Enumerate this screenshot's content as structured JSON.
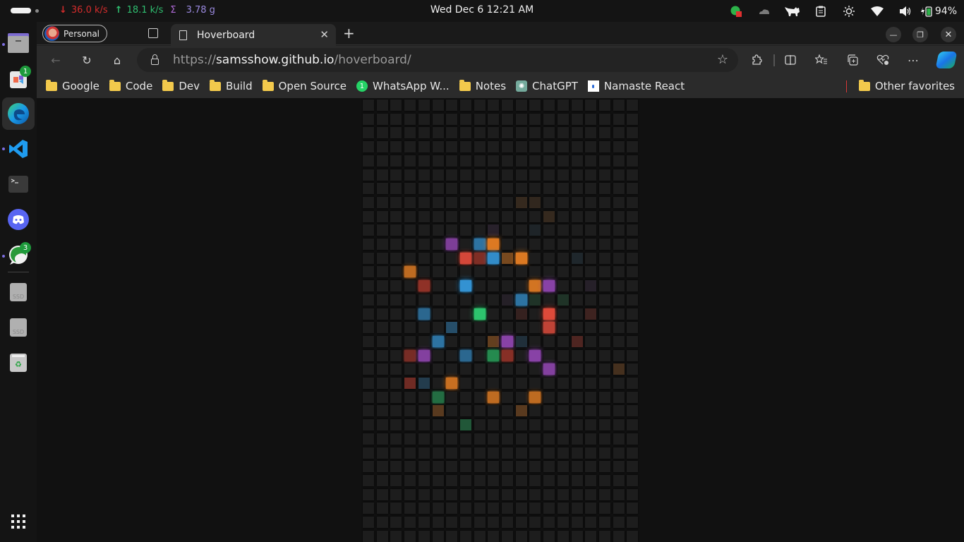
{
  "system_bar": {
    "net_down_icon": "arrow-down-icon",
    "net_down": "36.0 k/s",
    "net_up_icon": "arrow-up-icon",
    "net_up": "18.1 k/s",
    "total_icon": "sigma-icon",
    "net_total": "3.78 g",
    "clock": "Wed Dec 6  12:21 AM",
    "tray_icons": [
      "whatsapp-notification-icon",
      "cloud-icon",
      "cat-icon",
      "clipboard-icon",
      "brightness-icon",
      "wifi-icon",
      "volume-icon"
    ],
    "battery": "94%"
  },
  "dock": {
    "items": [
      {
        "name": "files",
        "icon": "folder-icon",
        "running": true
      },
      {
        "name": "software-store",
        "icon": "store-icon",
        "badge": "1"
      },
      {
        "name": "edge",
        "icon": "edge-icon",
        "running": true,
        "active": true
      },
      {
        "name": "vscode",
        "icon": "vscode-icon",
        "running": true
      },
      {
        "name": "terminal",
        "icon": "terminal-icon"
      },
      {
        "name": "discord",
        "icon": "discord-icon"
      },
      {
        "name": "whatsapp",
        "icon": "whatsapp-icon",
        "running": true,
        "badge": "3"
      },
      {
        "name": "ssd-1",
        "icon": "drive-icon",
        "label": "SSD"
      },
      {
        "name": "ssd-2",
        "icon": "drive-icon",
        "label": "SSD"
      },
      {
        "name": "trash",
        "icon": "trash-icon"
      }
    ],
    "apps_grid_icon": "apps-grid-icon"
  },
  "browser": {
    "profile_label": "Personal",
    "tab_title": "Hoverboard",
    "url": {
      "protocol": "https://",
      "host": "samsshow.github.io",
      "path": "/hoverboard/"
    },
    "bookmarks": [
      {
        "label": "Google",
        "icon": "folder"
      },
      {
        "label": "Code",
        "icon": "folder"
      },
      {
        "label": "Dev",
        "icon": "folder"
      },
      {
        "label": "Build",
        "icon": "folder"
      },
      {
        "label": "Open Source",
        "icon": "folder"
      },
      {
        "label": "WhatsApp W...",
        "icon": "whatsapp",
        "badge": "1"
      },
      {
        "label": "Notes",
        "icon": "folder"
      },
      {
        "label": "ChatGPT",
        "icon": "chatgpt"
      },
      {
        "label": "Namaste React",
        "icon": "namaste"
      }
    ],
    "other_favorites": "Other favorites"
  },
  "hoverboard": {
    "columns": 20,
    "rows": 32,
    "base_color": "#1d1d1d",
    "lit_cells": [
      {
        "row": 7,
        "col": 11,
        "color": "#e67e22",
        "intensity": 0.12
      },
      {
        "row": 7,
        "col": 12,
        "color": "#e67e22",
        "intensity": 0.1
      },
      {
        "row": 8,
        "col": 13,
        "color": "#e67e22",
        "intensity": 0.12
      },
      {
        "row": 9,
        "col": 9,
        "color": "#8e44ad",
        "intensity": 0.1
      },
      {
        "row": 9,
        "col": 12,
        "color": "#3498db",
        "intensity": 0.06
      },
      {
        "row": 10,
        "col": 6,
        "color": "#8e44ad",
        "intensity": 0.85
      },
      {
        "row": 10,
        "col": 8,
        "color": "#3498db",
        "intensity": 0.7
      },
      {
        "row": 10,
        "col": 9,
        "color": "#e67e22",
        "intensity": 0.95
      },
      {
        "row": 11,
        "col": 7,
        "color": "#e74c3c",
        "intensity": 0.9
      },
      {
        "row": 11,
        "col": 8,
        "color": "#c0392b",
        "intensity": 0.6
      },
      {
        "row": 11,
        "col": 9,
        "color": "#3498db",
        "intensity": 0.9
      },
      {
        "row": 11,
        "col": 10,
        "color": "#e67e22",
        "intensity": 0.45
      },
      {
        "row": 11,
        "col": 11,
        "color": "#e67e22",
        "intensity": 0.95
      },
      {
        "row": 11,
        "col": 15,
        "color": "#3498db",
        "intensity": 0.08
      },
      {
        "row": 12,
        "col": 3,
        "color": "#e67e22",
        "intensity": 0.8
      },
      {
        "row": 13,
        "col": 4,
        "color": "#c0392b",
        "intensity": 0.7
      },
      {
        "row": 13,
        "col": 7,
        "color": "#3498db",
        "intensity": 0.95
      },
      {
        "row": 13,
        "col": 12,
        "color": "#e67e22",
        "intensity": 0.9
      },
      {
        "row": 13,
        "col": 13,
        "color": "#8e44ad",
        "intensity": 0.95
      },
      {
        "row": 13,
        "col": 16,
        "color": "#8e44ad",
        "intensity": 0.08
      },
      {
        "row": 14,
        "col": 10,
        "color": "#8e44ad",
        "intensity": 0.07
      },
      {
        "row": 14,
        "col": 11,
        "color": "#3498db",
        "intensity": 0.7
      },
      {
        "row": 14,
        "col": 12,
        "color": "#27ae60",
        "intensity": 0.15
      },
      {
        "row": 14,
        "col": 14,
        "color": "#27ae60",
        "intensity": 0.15
      },
      {
        "row": 15,
        "col": 4,
        "color": "#3498db",
        "intensity": 0.6
      },
      {
        "row": 15,
        "col": 8,
        "color": "#2ecc71",
        "intensity": 0.95
      },
      {
        "row": 15,
        "col": 11,
        "color": "#c0392b",
        "intensity": 0.15
      },
      {
        "row": 15,
        "col": 13,
        "color": "#e74c3c",
        "intensity": 0.95
      },
      {
        "row": 15,
        "col": 16,
        "color": "#c0392b",
        "intensity": 0.2
      },
      {
        "row": 16,
        "col": 6,
        "color": "#3498db",
        "intensity": 0.4
      },
      {
        "row": 16,
        "col": 13,
        "color": "#e74c3c",
        "intensity": 0.8
      },
      {
        "row": 17,
        "col": 5,
        "color": "#3498db",
        "intensity": 0.7
      },
      {
        "row": 17,
        "col": 9,
        "color": "#e67e22",
        "intensity": 0.35
      },
      {
        "row": 17,
        "col": 10,
        "color": "#8e44ad",
        "intensity": 0.95
      },
      {
        "row": 17,
        "col": 11,
        "color": "#3498db",
        "intensity": 0.15
      },
      {
        "row": 17,
        "col": 15,
        "color": "#c0392b",
        "intensity": 0.3
      },
      {
        "row": 18,
        "col": 3,
        "color": "#c0392b",
        "intensity": 0.55
      },
      {
        "row": 18,
        "col": 4,
        "color": "#8e44ad",
        "intensity": 0.9
      },
      {
        "row": 18,
        "col": 7,
        "color": "#3498db",
        "intensity": 0.6
      },
      {
        "row": 18,
        "col": 9,
        "color": "#27ae60",
        "intensity": 0.75
      },
      {
        "row": 18,
        "col": 10,
        "color": "#c0392b",
        "intensity": 0.65
      },
      {
        "row": 18,
        "col": 12,
        "color": "#8e44ad",
        "intensity": 0.95
      },
      {
        "row": 19,
        "col": 13,
        "color": "#8e44ad",
        "intensity": 0.9
      },
      {
        "row": 19,
        "col": 18,
        "color": "#e67e22",
        "intensity": 0.2
      },
      {
        "row": 20,
        "col": 3,
        "color": "#c0392b",
        "intensity": 0.5
      },
      {
        "row": 20,
        "col": 4,
        "color": "#3498db",
        "intensity": 0.25
      },
      {
        "row": 20,
        "col": 6,
        "color": "#e67e22",
        "intensity": 0.85
      },
      {
        "row": 21,
        "col": 5,
        "color": "#27ae60",
        "intensity": 0.55
      },
      {
        "row": 21,
        "col": 9,
        "color": "#e67e22",
        "intensity": 0.8
      },
      {
        "row": 21,
        "col": 12,
        "color": "#e67e22",
        "intensity": 0.8
      },
      {
        "row": 22,
        "col": 5,
        "color": "#e67e22",
        "intensity": 0.3
      },
      {
        "row": 22,
        "col": 11,
        "color": "#e67e22",
        "intensity": 0.3
      },
      {
        "row": 23,
        "col": 7,
        "color": "#27ae60",
        "intensity": 0.4
      }
    ]
  }
}
